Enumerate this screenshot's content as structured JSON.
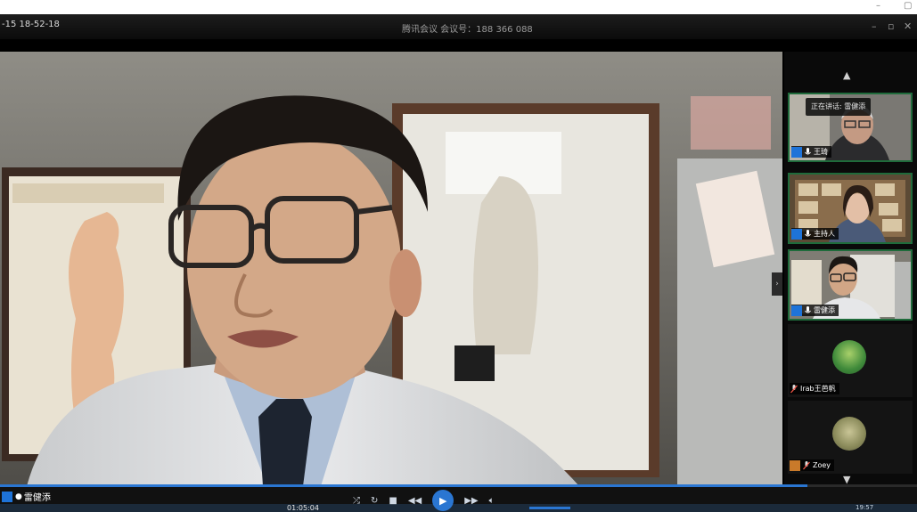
{
  "window": {
    "minimize_glyph": "–",
    "maximize_glyph": "▢"
  },
  "meeting": {
    "timestamp": "-15 18-52-18",
    "title": "腾讯会议 会议号：188 366 088",
    "controls": [
      "–",
      "▫",
      "✕"
    ]
  },
  "participants": {
    "nav_up": "▲",
    "nav_down": "▼",
    "speaking_indicator": "正在讲话: 雷健添",
    "tiles": [
      {
        "name": "王琦",
        "type": "video"
      },
      {
        "name": "主持人",
        "type": "video"
      },
      {
        "name": "雷健添",
        "type": "video"
      },
      {
        "name": "Irab王芭帆",
        "type": "avatar"
      },
      {
        "name": "Zoey",
        "type": "avatar"
      }
    ]
  },
  "player": {
    "current_speaker": "雷健添",
    "elapsed": "01:05:04",
    "progress_fraction": 0.88,
    "clock": "19:57",
    "icons": [
      "shuffle-icon",
      "loop-icon",
      "stop-icon",
      "prev-icon",
      "play-icon",
      "next-icon",
      "volume-icon"
    ]
  },
  "colors": {
    "accent": "#2a76d2",
    "active_border": "#1f6b3b",
    "person_icon": "#1e73d8"
  }
}
